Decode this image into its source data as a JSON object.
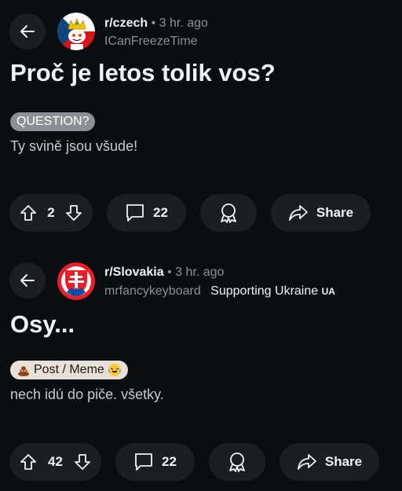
{
  "posts": [
    {
      "subreddit": "r/czech",
      "time": "3 hr. ago",
      "separator": "•",
      "author": "ICanFreezeTime",
      "author_flair": "",
      "title": "Proč je letos tolik vos?",
      "flair": "QUESTION?",
      "body": "Ty svině jsou všude!",
      "upvotes": "2",
      "comments": "22",
      "share_label": "Share"
    },
    {
      "subreddit": "r/Slovakia",
      "time": "3 hr. ago",
      "separator": "•",
      "author": "mrfancykeyboard",
      "author_flair": "Supporting Ukraine",
      "author_flair_badge": "UA",
      "title": "Osy...",
      "flair": "Post / Meme",
      "body": "nech idú do piče. všetky.",
      "upvotes": "42",
      "comments": "22",
      "share_label": "Share"
    }
  ],
  "icons": {
    "back": "arrow-left-icon",
    "upvote": "arrow-up-icon",
    "downvote": "arrow-down-icon",
    "comment": "speech-bubble-icon",
    "award": "award-medal-icon",
    "share": "share-arrow-icon"
  },
  "colors": {
    "background": "#0b0e10",
    "pill": "#1a1f23",
    "muted_text": "#8a9095",
    "question_flair": "#8a9095",
    "meme_flair": "#e8e0d8"
  }
}
